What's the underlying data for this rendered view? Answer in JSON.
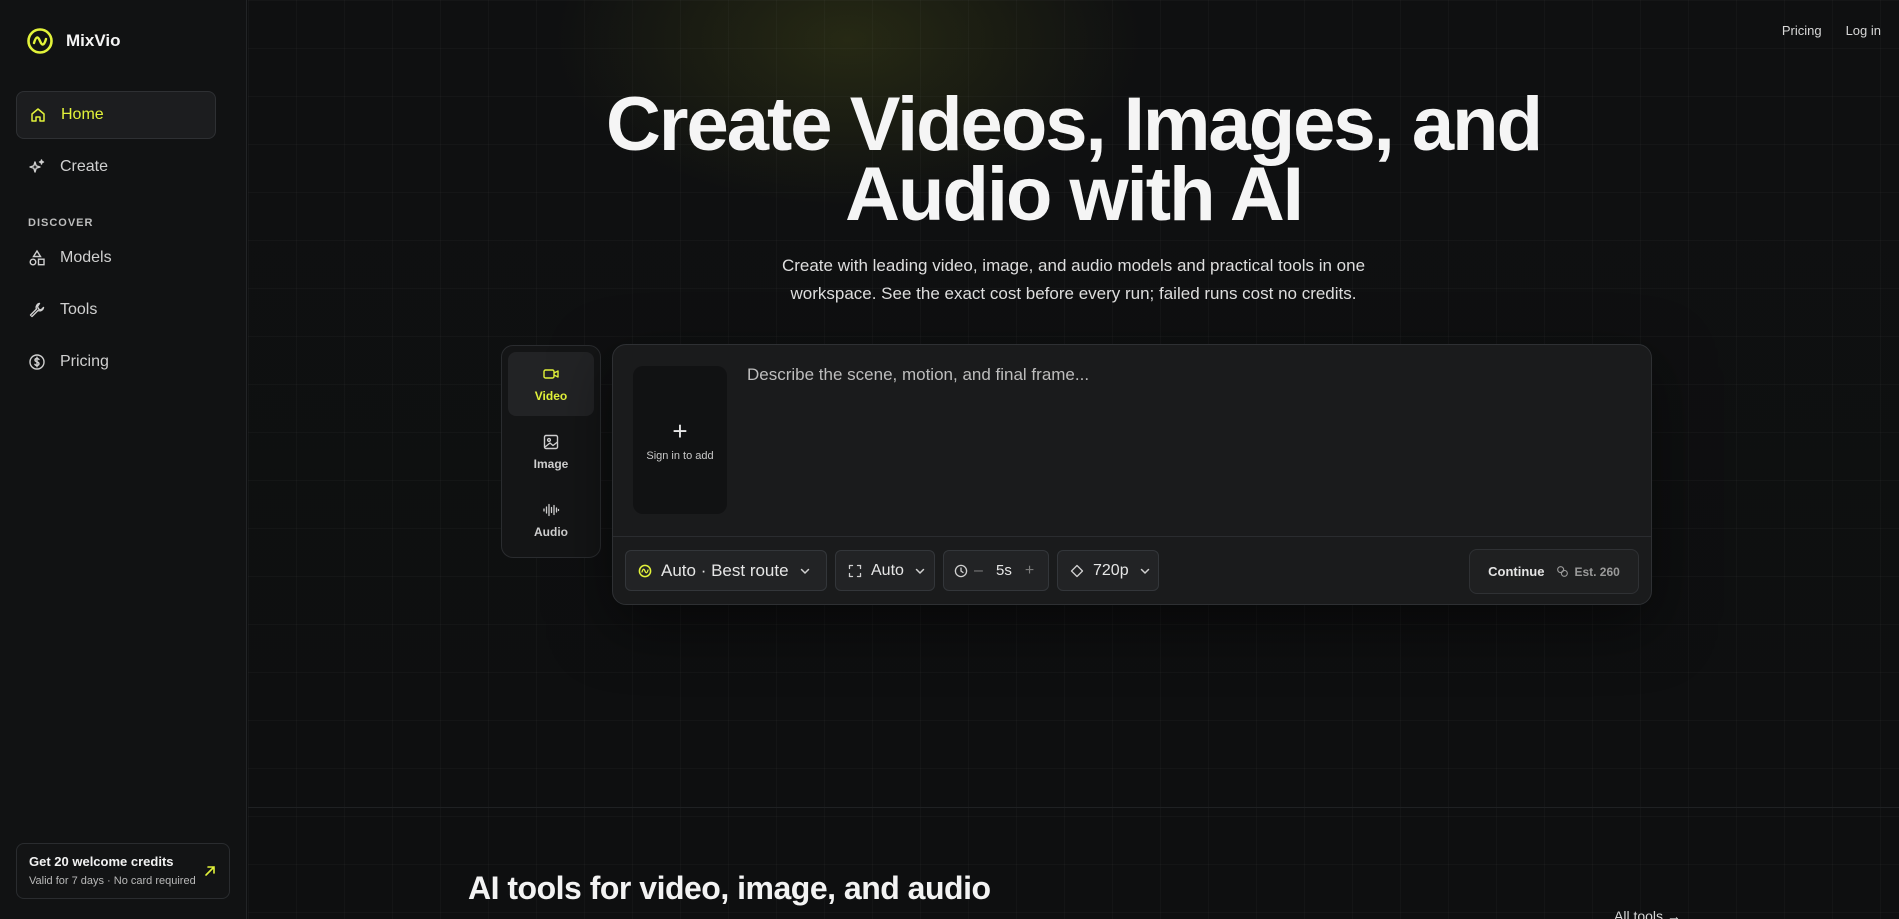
{
  "colors": {
    "accent": "#e2f23a",
    "background": "#0e0f10",
    "sidebar": "#111213"
  },
  "brand": {
    "name": "MixVio"
  },
  "sidebar": {
    "items": [
      {
        "label": "Home",
        "icon": "home-icon",
        "active": true
      },
      {
        "label": "Create",
        "icon": "sparkle-icon"
      },
      {
        "label": "Models",
        "icon": "shapes-icon"
      },
      {
        "label": "Tools",
        "icon": "wrench-icon"
      },
      {
        "label": "Pricing",
        "icon": "dollar-circle-icon"
      }
    ],
    "section_label": "DISCOVER",
    "promo": {
      "title": "Get 20 welcome credits",
      "subtitle": "Valid for 7 days · No card required"
    }
  },
  "header": {
    "links": [
      "Pricing",
      "Log in"
    ]
  },
  "hero": {
    "title": "Create Videos, Images, and\nAudio with AI",
    "subtitle": "Create with leading video, image, and audio models and practical tools in one\nworkspace. See the exact cost before every run; failed runs cost no credits."
  },
  "modes": [
    {
      "label": "Video",
      "icon": "video-icon",
      "active": true
    },
    {
      "label": "Image",
      "icon": "image-icon"
    },
    {
      "label": "Audio",
      "icon": "waveform-icon"
    }
  ],
  "composer": {
    "upload_label": "Sign in to add",
    "prompt_placeholder": "Describe the scene, motion, and final frame...",
    "route": "Auto · Best route",
    "aspect": "Auto",
    "duration": "5s",
    "resolution": "720p",
    "continue_label": "Continue",
    "estimate": "Est. 260"
  },
  "tools_section": {
    "title": "AI tools for video, image, and audio",
    "all_link": "All tools →"
  }
}
